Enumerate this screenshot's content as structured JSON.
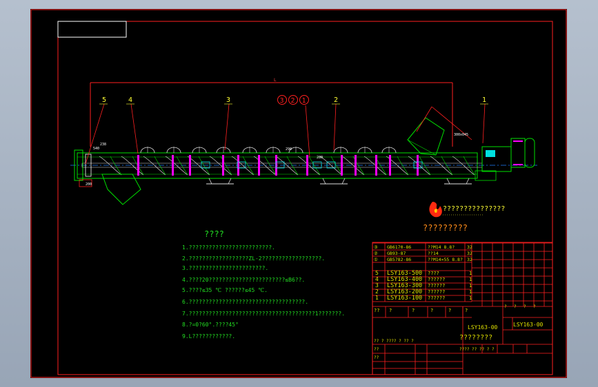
{
  "drawing": {
    "dimension_total": "L",
    "dim_left_1": "540",
    "dim_left_2": "238",
    "dim_left_3": "200",
    "dim_center_1": "290",
    "dim_center_2": "280",
    "dim_right_1": "300x045",
    "part_labels": [
      "5",
      "4",
      "3",
      "2",
      "1"
    ],
    "circled_labels": [
      "3",
      "2",
      "1"
    ],
    "flame_text": "???????????????",
    "flame_subtext": "?????????"
  },
  "notes": {
    "title": "????",
    "lines": [
      "1.?????????????????????????.",
      "2.??????????????????ZL-2??????????????????.",
      "3.???????????????????????.",
      "4.????20???????????????????????≤B6??.",
      "5.????≤35 ℃  ??????≤45 ℃.",
      "6.???????????????????????????????????.",
      "7.??????????????????????????????????????1???????.",
      "8.?=0?60°.????45°",
      "9.L????????????."
    ]
  },
  "parts_list": {
    "std_rows": [
      {
        "idx": "③",
        "code": "GB6170-86",
        "spec": "??M14  8.8?",
        "qty": "32"
      },
      {
        "idx": "②",
        "code": "GB93-87",
        "spec": "??14",
        "qty": "32"
      },
      {
        "idx": "①",
        "code": "GB5782-86",
        "spec": "??M14×55  8.8?",
        "qty": "32"
      }
    ],
    "rows": [
      {
        "idx": "5",
        "code": "LSY163-500",
        "name": "????",
        "qty": "1"
      },
      {
        "idx": "4",
        "code": "LSY163-400",
        "name": "??????",
        "qty": "1"
      },
      {
        "idx": "3",
        "code": "LSY163-300",
        "name": "??????",
        "qty": "1"
      },
      {
        "idx": "2",
        "code": "LSY163-200",
        "name": "??????",
        "qty": "1"
      },
      {
        "idx": "1",
        "code": "LSY163-100",
        "name": "??????",
        "qty": "1"
      }
    ],
    "header_cells": [
      "??",
      "?",
      "?",
      "?",
      "?",
      "?"
    ]
  },
  "title_block": {
    "drawing_no": "LSY163-00",
    "drawing_no_2": "LSY163-00",
    "drawing_name": "????????",
    "mini_left": [
      "??  ?  ????  ?  ??  ?",
      "??",
      "??"
    ],
    "mini_mid": "????   ?? ??   ?   ?",
    "scale_headers": [
      "?",
      "?",
      "?",
      "?"
    ]
  },
  "colors": {
    "border": "#ff1a1a",
    "notes": "#22dd22",
    "parts_text": "#e0e000",
    "label_text": "#ffff33",
    "body": "#00e000",
    "accent": "#ff00ff",
    "dim": "#ff2020",
    "axis": "#2080ff"
  }
}
